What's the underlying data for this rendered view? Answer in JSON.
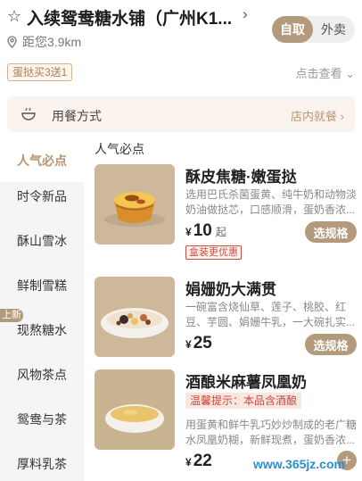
{
  "store": {
    "name": "入续鸳鸯糖水铺（广州K1...",
    "distance": "距您3.9km"
  },
  "order_mode": {
    "options": [
      "自取",
      "外卖"
    ],
    "selected": "自取"
  },
  "promo": {
    "badge": "蛋挞买3送1",
    "view_link": "点击查看"
  },
  "dining": {
    "label": "用餐方式",
    "value": "店内就餐"
  },
  "sidebar": {
    "items": [
      {
        "label": "人气必点",
        "active": true
      },
      {
        "label": "时令新品"
      },
      {
        "label": "酥山雪冰"
      },
      {
        "label": "鲜制雪糕"
      },
      {
        "label": "现熬糖水"
      },
      {
        "label": "风物茶点"
      },
      {
        "label": "鸳鸯与茶"
      },
      {
        "label": "厚料乳茶"
      }
    ],
    "new_badge": "上新"
  },
  "section": {
    "title": "人气必点"
  },
  "products": [
    {
      "name": "酥皮焦糖·嫩蛋挞",
      "desc": "选用巴氏杀菌蛋黄、纯牛奶和动物淡奶油做挞芯，口感顺滑，蛋奶香浓...",
      "tag": "盒装更优惠",
      "currency": "¥",
      "price": "10",
      "unit": "起",
      "button": "选规格"
    },
    {
      "name": "娟姗奶大满贯",
      "desc": "一碗富含烧仙草、莲子、桃胶、红豆、芋圆、娟姗牛乳，一大碗扎实...",
      "currency": "¥",
      "price": "25",
      "button": "选规格"
    },
    {
      "name": "酒酿米麻薯凤凰奶",
      "tag": "温馨提示：本品含酒酿",
      "desc": "用蛋黄和鲜牛乳巧妙炒制成的老广糖水凤凰奶糊，新鲜现煮，蛋奶香浓...",
      "currency": "¥",
      "price": "22",
      "button": "+"
    }
  ],
  "watermark": "www.365jz.com",
  "colors": {
    "accent": "#b49a7d",
    "tag_red": "#d24a3a",
    "sidebar_bg": "#f5f5f5"
  }
}
